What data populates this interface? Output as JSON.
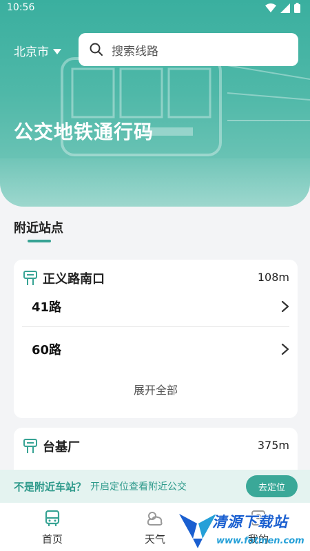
{
  "status_bar": {
    "time": "10:56"
  },
  "header": {
    "city": "北京市",
    "search_placeholder": "搜索线路",
    "title": "公交地铁通行码"
  },
  "nearby": {
    "section_title": "附近站点",
    "stops": [
      {
        "name": "正义路南口",
        "distance": "108m",
        "routes": [
          "41路",
          "60路"
        ],
        "expand_label": "展开全部"
      },
      {
        "name": "台基厂",
        "distance": "375m"
      }
    ]
  },
  "location_banner": {
    "question": "不是附近车站？",
    "hint": "开启定位查看附近公交",
    "button": "去定位"
  },
  "nav": {
    "items": [
      {
        "label": "首页",
        "icon": "bus-icon"
      },
      {
        "label": "天气",
        "icon": "weather-icon"
      },
      {
        "label": "我的",
        "icon": "user-icon"
      }
    ]
  },
  "watermark": {
    "text": "清源下载站",
    "url": "www.fotmen.com"
  },
  "colors": {
    "accent": "#37a394",
    "banner_bg": "#e4f3f0"
  }
}
